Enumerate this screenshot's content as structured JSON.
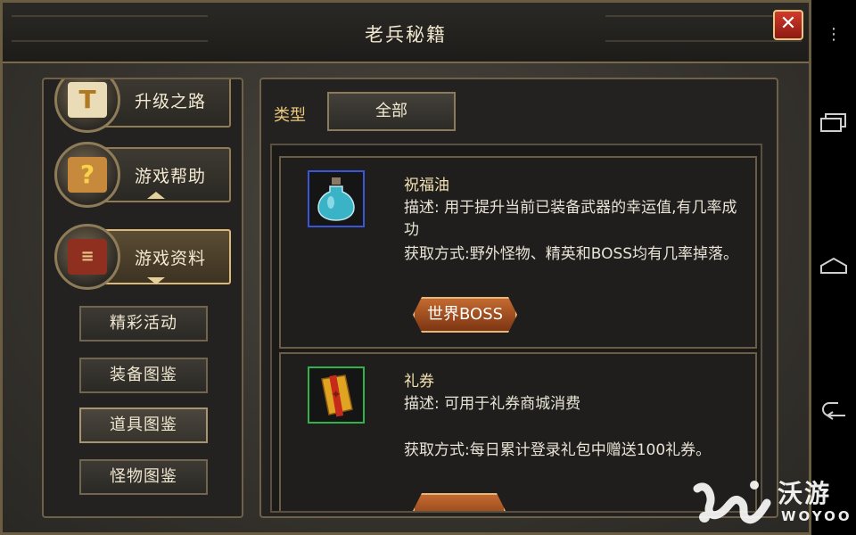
{
  "window": {
    "title": "老兵秘籍"
  },
  "categories": [
    {
      "label": "升级之路",
      "icon": "scroll-book-icon"
    },
    {
      "label": "游戏帮助",
      "icon": "question-book-icon"
    },
    {
      "label": "游戏资料",
      "icon": "red-book-icon"
    }
  ],
  "subcategories": [
    "精彩活动",
    "装备图鉴",
    "道具图鉴",
    "怪物图鉴"
  ],
  "filter": {
    "type_label": "类型",
    "type_value": "全部"
  },
  "items": [
    {
      "name": "祝福油",
      "icon": "potion-bottle-icon",
      "description": "描述: 用于提升当前已装备武器的幸运值,有几率成功",
      "obtain": "获取方式:野外怪物、精英和BOSS均有几率掉落。",
      "button": "世界BOSS"
    },
    {
      "name": "礼券",
      "icon": "gift-voucher-icon",
      "description": "描述: 可用于礼券商城消费",
      "obtain": "获取方式:每日累计登录礼包中赠送100礼券。"
    }
  ],
  "colors": {
    "accent_gold": "#e8c87a",
    "frame": "#6e6148",
    "close_red": "#c8301f"
  },
  "watermark": {
    "cn": "沃游",
    "en": "WOYOO"
  }
}
